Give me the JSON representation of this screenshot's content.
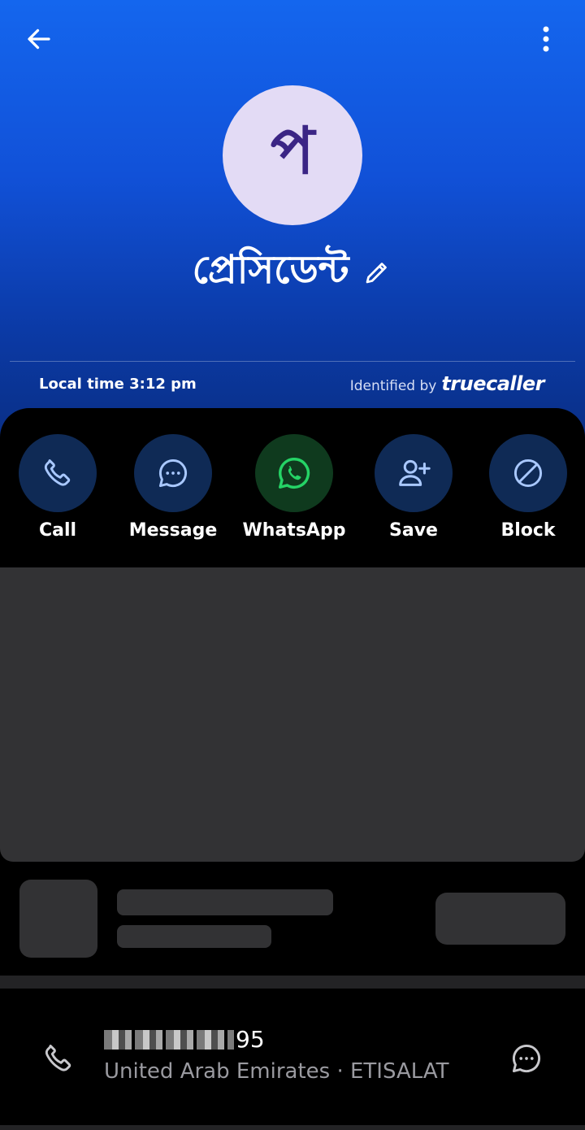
{
  "contact": {
    "avatar_letter": "প",
    "name": "প্রেসিডেন্ট",
    "local_time": "Local time 3:12 pm",
    "identified_prefix": "Identified by",
    "identified_brand": "truecaller"
  },
  "actions": [
    {
      "label": "Call",
      "icon": "phone-icon"
    },
    {
      "label": "Message",
      "icon": "message-icon"
    },
    {
      "label": "WhatsApp",
      "icon": "whatsapp-icon"
    },
    {
      "label": "Save",
      "icon": "add-contact-icon"
    },
    {
      "label": "Block",
      "icon": "block-icon"
    }
  ],
  "number_entry": {
    "number_suffix": "95",
    "carrier": "United Arab Emirates · ETISALAT"
  },
  "colors": {
    "header_top": "#1466ee",
    "header_bottom": "#0a2f86",
    "avatar_bg": "#e3dbf5",
    "action_circle": "#0f2a55",
    "whatsapp_green": "#25d366"
  }
}
